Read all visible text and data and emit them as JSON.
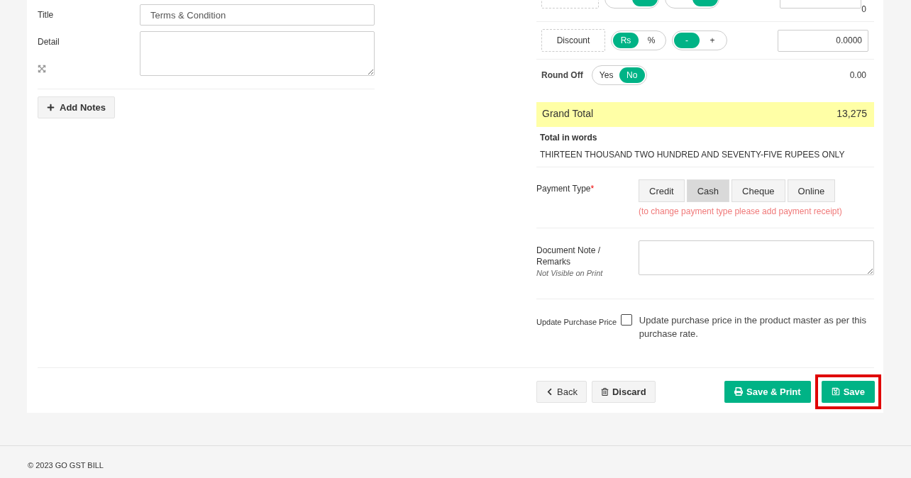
{
  "notes": {
    "fields": [
      {
        "kind": "input",
        "label": "Title",
        "value": "Terms & Condition"
      },
      {
        "kind": "textarea",
        "label": "Detail"
      }
    ],
    "add_button": "Add Notes"
  },
  "summary": {
    "cut_row": {
      "value": "0",
      "toggles": [
        {
          "on": true
        },
        {
          "on": true
        }
      ]
    },
    "discount": {
      "label": "Discount",
      "toggles": [
        {
          "options": [
            {
              "label": "Rs",
              "selected": true
            },
            {
              "label": "%",
              "selected": false
            }
          ]
        },
        {
          "options": [
            {
              "label": "-",
              "selected": true
            },
            {
              "label": "+",
              "selected": false
            }
          ]
        }
      ],
      "value": "0.0000"
    },
    "round_off": {
      "label": "Round Off",
      "options": [
        {
          "label": "Yes",
          "selected": false
        },
        {
          "label": "No",
          "selected": true
        }
      ],
      "value": "0.00"
    },
    "grand_total": {
      "label": "Grand Total",
      "value": "13,275"
    },
    "total_in_words": {
      "label": "Total in words",
      "value": "THIRTEEN THOUSAND TWO HUNDRED AND SEVENTY-FIVE RUPEES ONLY"
    }
  },
  "payment": {
    "label": "Payment Type",
    "required_mark": "*",
    "options": [
      {
        "label": "Credit",
        "selected": false
      },
      {
        "label": "Cash",
        "selected": true
      },
      {
        "label": "Cheque",
        "selected": false
      },
      {
        "label": "Online",
        "selected": false
      }
    ],
    "hint": "(to change payment type please add payment receipt)"
  },
  "remarks": {
    "label": "Document Note / Remarks",
    "sublabel": "Not Visible on Print"
  },
  "update_price": {
    "label": "Update Purchase Price",
    "checked": false,
    "text": "Update purchase price in the product master as per this purchase rate."
  },
  "actions": [
    {
      "kind": "back",
      "label": "Back",
      "highlighted": false
    },
    {
      "kind": "discard",
      "label": "Discard",
      "highlighted": false
    },
    {
      "kind": "save_print",
      "label": "Save & Print",
      "highlighted": false
    },
    {
      "kind": "save",
      "label": "Save",
      "highlighted": true
    }
  ],
  "footer": "© 2023 GO GST BILL"
}
